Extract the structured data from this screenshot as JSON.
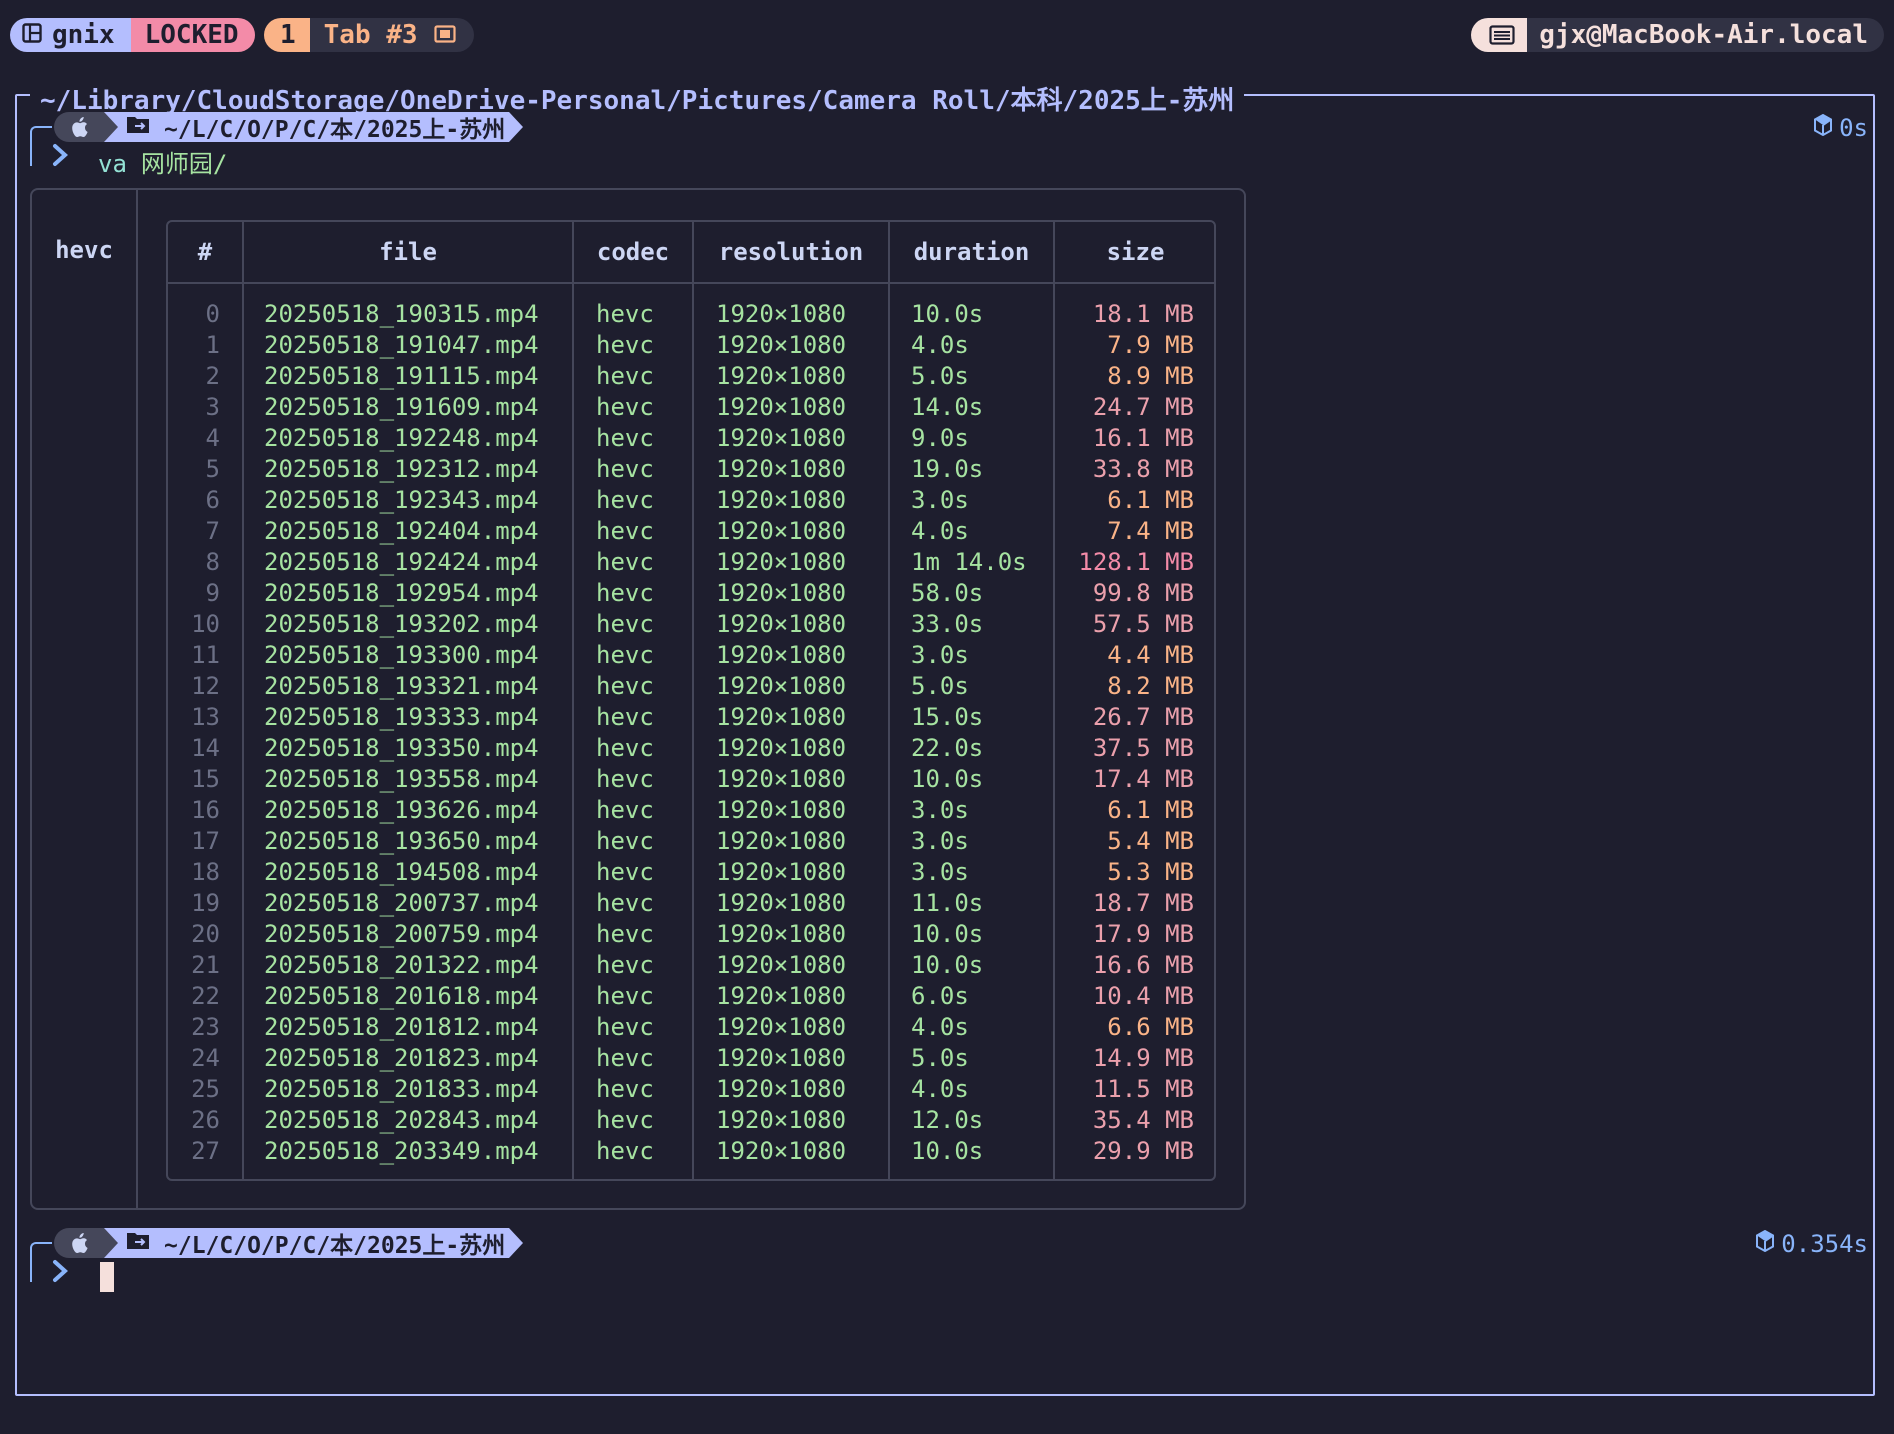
{
  "topbar": {
    "session_name": "gnix",
    "mode": "LOCKED",
    "tab_number": "1",
    "tab_name": "Tab #3",
    "host": "gjx@MacBook-Air.local"
  },
  "pane": {
    "title": "~/Library/CloudStorage/OneDrive-Personal/Pictures/Camera Roll/本科/2025上-苏州"
  },
  "prompt1": {
    "path": "~/L/C/O/P/C/本/2025上-苏州",
    "command": "va",
    "argument": "网师园/",
    "duration": "0s"
  },
  "prompt2": {
    "path": "~/L/C/O/P/C/本/2025上-苏州",
    "duration": "0.354s"
  },
  "group_label": "hevc",
  "table": {
    "headers": {
      "idx": "#",
      "file": "file",
      "codec": "codec",
      "resolution": "resolution",
      "duration": "duration",
      "size": "size"
    },
    "rows": [
      {
        "idx": "0",
        "file": "20250518_190315.mp4",
        "codec": "hevc",
        "resolution": "1920×1080",
        "duration": "10.0s",
        "size": "18.1 MB",
        "level": "high"
      },
      {
        "idx": "1",
        "file": "20250518_191047.mp4",
        "codec": "hevc",
        "resolution": "1920×1080",
        "duration": "4.0s",
        "size": "7.9 MB",
        "level": "low"
      },
      {
        "idx": "2",
        "file": "20250518_191115.mp4",
        "codec": "hevc",
        "resolution": "1920×1080",
        "duration": "5.0s",
        "size": "8.9 MB",
        "level": "low"
      },
      {
        "idx": "3",
        "file": "20250518_191609.mp4",
        "codec": "hevc",
        "resolution": "1920×1080",
        "duration": "14.0s",
        "size": "24.7 MB",
        "level": "high"
      },
      {
        "idx": "4",
        "file": "20250518_192248.mp4",
        "codec": "hevc",
        "resolution": "1920×1080",
        "duration": "9.0s",
        "size": "16.1 MB",
        "level": "high"
      },
      {
        "idx": "5",
        "file": "20250518_192312.mp4",
        "codec": "hevc",
        "resolution": "1920×1080",
        "duration": "19.0s",
        "size": "33.8 MB",
        "level": "high"
      },
      {
        "idx": "6",
        "file": "20250518_192343.mp4",
        "codec": "hevc",
        "resolution": "1920×1080",
        "duration": "3.0s",
        "size": "6.1 MB",
        "level": "low"
      },
      {
        "idx": "7",
        "file": "20250518_192404.mp4",
        "codec": "hevc",
        "resolution": "1920×1080",
        "duration": "4.0s",
        "size": "7.4 MB",
        "level": "low"
      },
      {
        "idx": "8",
        "file": "20250518_192424.mp4",
        "codec": "hevc",
        "resolution": "1920×1080",
        "duration": "1m 14.0s",
        "size": "128.1 MB",
        "level": "max"
      },
      {
        "idx": "9",
        "file": "20250518_192954.mp4",
        "codec": "hevc",
        "resolution": "1920×1080",
        "duration": "58.0s",
        "size": "99.8 MB",
        "level": "high"
      },
      {
        "idx": "10",
        "file": "20250518_193202.mp4",
        "codec": "hevc",
        "resolution": "1920×1080",
        "duration": "33.0s",
        "size": "57.5 MB",
        "level": "high"
      },
      {
        "idx": "11",
        "file": "20250518_193300.mp4",
        "codec": "hevc",
        "resolution": "1920×1080",
        "duration": "3.0s",
        "size": "4.4 MB",
        "level": "low"
      },
      {
        "idx": "12",
        "file": "20250518_193321.mp4",
        "codec": "hevc",
        "resolution": "1920×1080",
        "duration": "5.0s",
        "size": "8.2 MB",
        "level": "low"
      },
      {
        "idx": "13",
        "file": "20250518_193333.mp4",
        "codec": "hevc",
        "resolution": "1920×1080",
        "duration": "15.0s",
        "size": "26.7 MB",
        "level": "high"
      },
      {
        "idx": "14",
        "file": "20250518_193350.mp4",
        "codec": "hevc",
        "resolution": "1920×1080",
        "duration": "22.0s",
        "size": "37.5 MB",
        "level": "high"
      },
      {
        "idx": "15",
        "file": "20250518_193558.mp4",
        "codec": "hevc",
        "resolution": "1920×1080",
        "duration": "10.0s",
        "size": "17.4 MB",
        "level": "high"
      },
      {
        "idx": "16",
        "file": "20250518_193626.mp4",
        "codec": "hevc",
        "resolution": "1920×1080",
        "duration": "3.0s",
        "size": "6.1 MB",
        "level": "low"
      },
      {
        "idx": "17",
        "file": "20250518_193650.mp4",
        "codec": "hevc",
        "resolution": "1920×1080",
        "duration": "3.0s",
        "size": "5.4 MB",
        "level": "low"
      },
      {
        "idx": "18",
        "file": "20250518_194508.mp4",
        "codec": "hevc",
        "resolution": "1920×1080",
        "duration": "3.0s",
        "size": "5.3 MB",
        "level": "low"
      },
      {
        "idx": "19",
        "file": "20250518_200737.mp4",
        "codec": "hevc",
        "resolution": "1920×1080",
        "duration": "11.0s",
        "size": "18.7 MB",
        "level": "high"
      },
      {
        "idx": "20",
        "file": "20250518_200759.mp4",
        "codec": "hevc",
        "resolution": "1920×1080",
        "duration": "10.0s",
        "size": "17.9 MB",
        "level": "high"
      },
      {
        "idx": "21",
        "file": "20250518_201322.mp4",
        "codec": "hevc",
        "resolution": "1920×1080",
        "duration": "10.0s",
        "size": "16.6 MB",
        "level": "high"
      },
      {
        "idx": "22",
        "file": "20250518_201618.mp4",
        "codec": "hevc",
        "resolution": "1920×1080",
        "duration": "6.0s",
        "size": "10.4 MB",
        "level": "high"
      },
      {
        "idx": "23",
        "file": "20250518_201812.mp4",
        "codec": "hevc",
        "resolution": "1920×1080",
        "duration": "4.0s",
        "size": "6.6 MB",
        "level": "low"
      },
      {
        "idx": "24",
        "file": "20250518_201823.mp4",
        "codec": "hevc",
        "resolution": "1920×1080",
        "duration": "5.0s",
        "size": "14.9 MB",
        "level": "high"
      },
      {
        "idx": "25",
        "file": "20250518_201833.mp4",
        "codec": "hevc",
        "resolution": "1920×1080",
        "duration": "4.0s",
        "size": "11.5 MB",
        "level": "high"
      },
      {
        "idx": "26",
        "file": "20250518_202843.mp4",
        "codec": "hevc",
        "resolution": "1920×1080",
        "duration": "12.0s",
        "size": "35.4 MB",
        "level": "high"
      },
      {
        "idx": "27",
        "file": "20250518_203349.mp4",
        "codec": "hevc",
        "resolution": "1920×1080",
        "duration": "10.0s",
        "size": "29.9 MB",
        "level": "high"
      }
    ]
  },
  "colors": {
    "background": "#1e1e2e",
    "accent": "#b4befe",
    "locked": "#f38ba8",
    "tab": "#fab387",
    "green": "#a6e3a1",
    "size_low": "#fab387",
    "size_high": "#eba0ac",
    "size_max": "#f38ba8",
    "index": "#6c7086",
    "border": "#45475a"
  },
  "icons": {
    "session": "layout-icon",
    "tab": "fullscreen-icon",
    "host": "server-icon",
    "os": "apple-icon",
    "folder": "folder-icon",
    "chevron": "chevron-right-icon",
    "timer": "hexagon-icon"
  }
}
